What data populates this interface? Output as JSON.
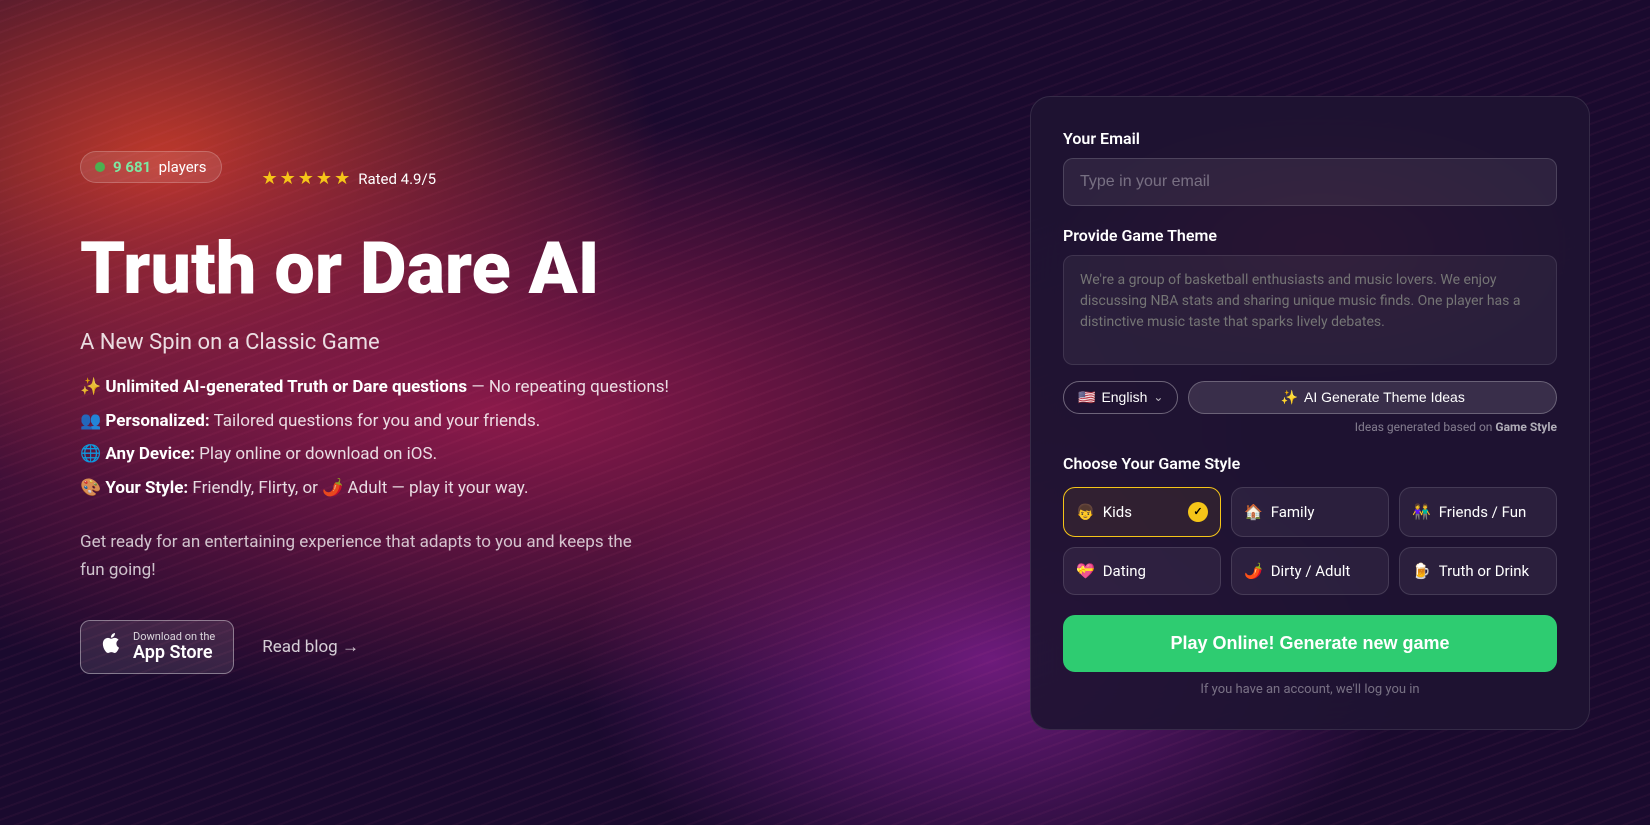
{
  "background": {
    "color": "#1a0a2e"
  },
  "left": {
    "badge": {
      "player_count": "9 681",
      "player_label": "players"
    },
    "rating": {
      "stars": "★★★★★",
      "text": "Rated 4.9/5"
    },
    "title": "Truth or Dare AI",
    "subtitle": "A New Spin on a Classic Game",
    "features": [
      {
        "icon": "✨",
        "bold": "Unlimited AI-generated Truth or Dare questions",
        "rest": " — No repeating questions!"
      },
      {
        "icon": "👥",
        "bold": "Personalized:",
        "rest": " Tailored questions for you and your friends."
      },
      {
        "icon": "🌐",
        "bold": "Any Device:",
        "rest": " Play online or download on iOS."
      },
      {
        "icon": "🎨",
        "bold": "Your Style:",
        "rest": " Friendly, Flirty, or 🌶️ Adult — play it your way."
      }
    ],
    "description": "Get ready for an entertaining experience that adapts to you and keeps the fun going!",
    "app_store": {
      "download_on": "Download on the",
      "store_name": "App Store"
    },
    "read_blog": "Read blog →"
  },
  "right": {
    "email_label": "Your Email",
    "email_placeholder": "Type in your email",
    "theme_label": "Provide Game Theme",
    "theme_placeholder": "We're a group of basketball enthusiasts and music lovers. We enjoy discussing NBA stats and sharing unique music finds. One player has a distinctive music taste that sparks lively debates.",
    "lang_btn": {
      "flag": "🇺🇸",
      "label": "English",
      "chevron": "⌃"
    },
    "ai_btn": {
      "icon": "✨",
      "label": "AI Generate Theme Ideas"
    },
    "hint_text": "Ideas generated based on ",
    "hint_bold": "Game Style",
    "game_style_label": "Choose Your Game Style",
    "styles": [
      {
        "icon": "👦",
        "label": "Kids",
        "selected": true
      },
      {
        "icon": "🏠",
        "label": "Family",
        "selected": false
      },
      {
        "icon": "👫",
        "label": "Friends / Fun",
        "selected": false
      },
      {
        "icon": "💝",
        "label": "Dating",
        "selected": false
      },
      {
        "icon": "🌶️",
        "label": "Dirty / Adult",
        "selected": false
      },
      {
        "icon": "🍺",
        "label": "Truth or Drink",
        "selected": false
      }
    ],
    "play_btn": "Play Online! Generate new game",
    "login_hint": "If you have an account, we'll log you in"
  }
}
